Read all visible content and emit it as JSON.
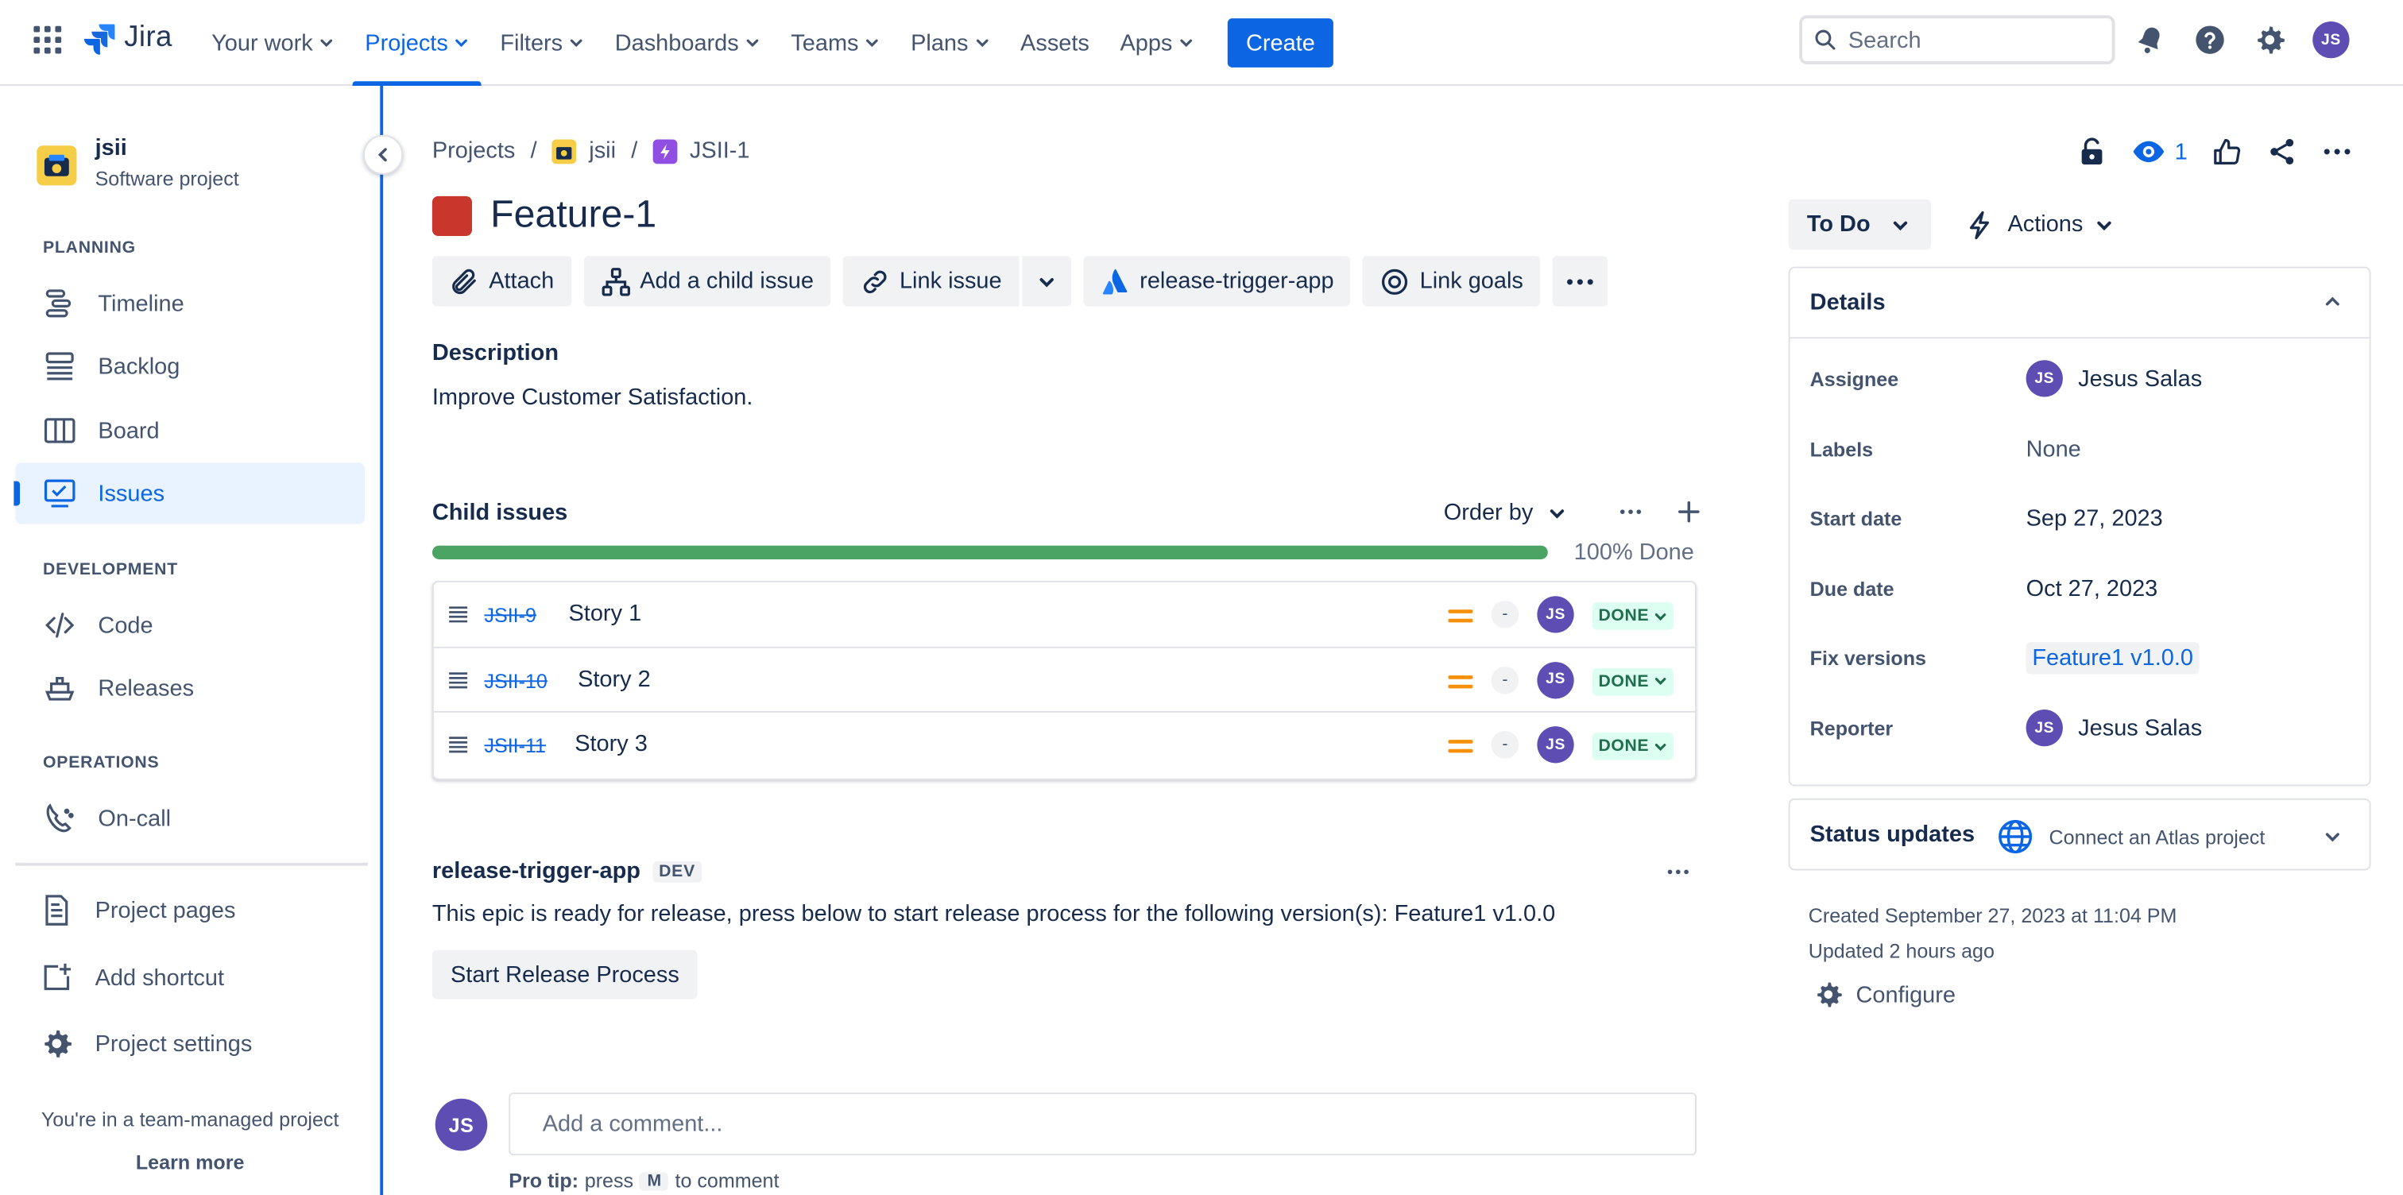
{
  "nav": {
    "logo": "Jira",
    "items": [
      {
        "label": "Your work",
        "dropdown": true
      },
      {
        "label": "Projects",
        "dropdown": true,
        "active": true
      },
      {
        "label": "Filters",
        "dropdown": true
      },
      {
        "label": "Dashboards",
        "dropdown": true
      },
      {
        "label": "Teams",
        "dropdown": true
      },
      {
        "label": "Plans",
        "dropdown": true
      },
      {
        "label": "Assets",
        "dropdown": false
      },
      {
        "label": "Apps",
        "dropdown": true
      }
    ],
    "create_label": "Create",
    "search_placeholder": "Search",
    "user_initials": "JS"
  },
  "sidebar": {
    "project_name": "jsii",
    "project_type": "Software project",
    "sections": {
      "planning": "PLANNING",
      "development": "DEVELOPMENT",
      "operations": "OPERATIONS"
    },
    "planning_items": [
      "Timeline",
      "Backlog",
      "Board",
      "Issues"
    ],
    "development_items": [
      "Code",
      "Releases"
    ],
    "operations_items": [
      "On-call"
    ],
    "bottom_items": [
      "Project pages",
      "Add shortcut",
      "Project settings"
    ],
    "team_msg": "You're in a team-managed project",
    "learn_more": "Learn more"
  },
  "breadcrumbs": {
    "root": "Projects",
    "project": "jsii",
    "issue": "JSII-1"
  },
  "issue": {
    "title": "Feature-1",
    "toolbar": {
      "attach": "Attach",
      "add_child": "Add a child issue",
      "link_issue": "Link issue",
      "app": "release-trigger-app",
      "link_goals": "Link goals"
    },
    "description_label": "Description",
    "description": "Improve Customer Satisfaction."
  },
  "child_issues": {
    "title": "Child issues",
    "order_by": "Order by",
    "progress_percent": 100,
    "progress_label": "100% Done",
    "rows": [
      {
        "key": "JSII-9",
        "summary": "Story 1",
        "estimate": "-",
        "assignee": "JS",
        "status": "DONE"
      },
      {
        "key": "JSII-10",
        "summary": "Story 2",
        "estimate": "-",
        "assignee": "JS",
        "status": "DONE"
      },
      {
        "key": "JSII-11",
        "summary": "Story 3",
        "estimate": "-",
        "assignee": "JS",
        "status": "DONE"
      }
    ]
  },
  "release_app": {
    "title": "release-trigger-app",
    "tag": "DEV",
    "text": "This epic is ready for release, press below to start release process for the following version(s): Feature1 v1.0.0",
    "button": "Start Release Process"
  },
  "comment": {
    "initials": "JS",
    "placeholder": "Add a comment...",
    "protip_prefix": "Pro tip:",
    "protip_press": "press",
    "protip_key": "M",
    "protip_suffix": "to comment"
  },
  "right": {
    "watchers": "1",
    "status": "To Do",
    "actions": "Actions",
    "details_title": "Details",
    "fields": {
      "assignee_label": "Assignee",
      "assignee": "Jesus Salas",
      "assignee_initials": "JS",
      "labels_label": "Labels",
      "labels": "None",
      "start_label": "Start date",
      "start": "Sep 27, 2023",
      "due_label": "Due date",
      "due": "Oct 27, 2023",
      "fix_label": "Fix versions",
      "fix": "Feature1 v1.0.0",
      "reporter_label": "Reporter",
      "reporter": "Jesus Salas",
      "reporter_initials": "JS"
    },
    "status_updates": "Status updates",
    "atlas_link": "Connect an Atlas project",
    "created": "Created September 27, 2023 at 11:04 PM",
    "updated": "Updated 2 hours ago",
    "configure": "Configure"
  },
  "colors": {
    "brand": "#0C66E4",
    "done_bar": "#4BA364",
    "epic": "#C9372C",
    "avatar": "#5E4DB2",
    "priority": "#F79009"
  }
}
